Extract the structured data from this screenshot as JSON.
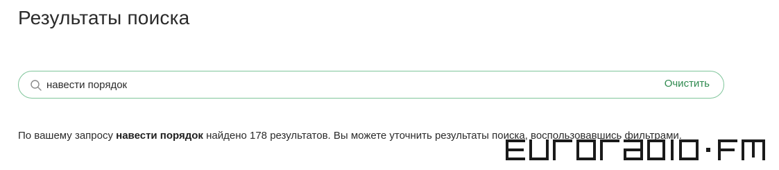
{
  "page": {
    "title": "Результаты поиска"
  },
  "search": {
    "value": "навести порядок",
    "clear_label": "Очистить",
    "icon": "search-icon"
  },
  "results": {
    "prefix": "По вашему запросу ",
    "query": "навести порядок",
    "suffix": " найдено 178 результатов. Вы можете уточнить результаты поиска, воспользовавшись фильтрами."
  },
  "watermark": {
    "text": "euroradio·fm"
  },
  "colors": {
    "accent": "#2f8a4f",
    "search_border": "#7fc59a",
    "text": "#2b2b2b"
  }
}
